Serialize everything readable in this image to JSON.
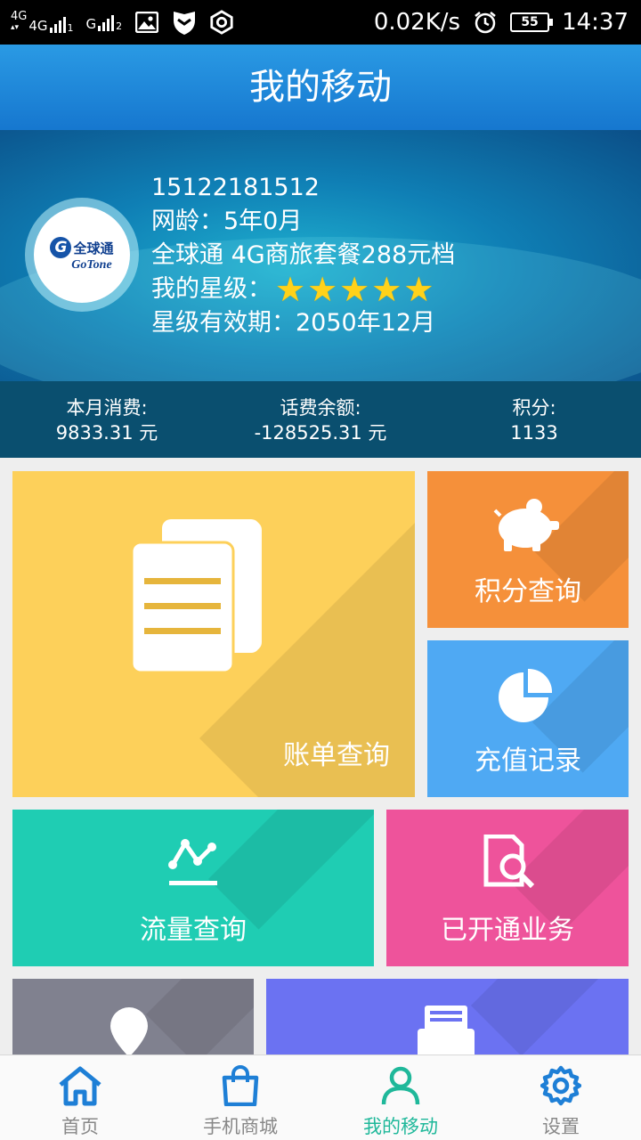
{
  "status_bar": {
    "sim1_label": "4G",
    "sim1_sub": "1",
    "sim2_label": "G",
    "sim2_sub": "2",
    "net_label": "4G",
    "speed": "0.02K/s",
    "battery": "55",
    "time": "14:37",
    "icons": [
      "image-icon",
      "shield-icon",
      "hexagon-settings-icon",
      "alarm-icon"
    ]
  },
  "header": {
    "title": "我的移动"
  },
  "profile": {
    "logo_cn": "全球通",
    "logo_en": "GoTone",
    "phone": "15122181512",
    "net_age": "网龄：5年0月",
    "plan": "全球通 4G商旅套餐288元档",
    "star_label": "我的星级：",
    "star_count": 5,
    "star_validity": "星级有效期：2050年12月"
  },
  "stats": [
    {
      "label": "本月消费:",
      "value": "9833.31 元"
    },
    {
      "label": "话费余额:",
      "value": "-128525.31 元"
    },
    {
      "label": "积分:",
      "value": "1133"
    }
  ],
  "tiles": {
    "bill": "账单查询",
    "points": "积分查询",
    "recharge": "充值记录",
    "flow": "流量查询",
    "services": "已开通业务"
  },
  "colors": {
    "bill": "#fdd05a",
    "points": "#f5903a",
    "recharge": "#4fa9f3",
    "flow": "#1fcdb3",
    "services": "#ee539b",
    "location": "#80818f",
    "print": "#6b72f2",
    "nav_active": "#1fb89a",
    "nav_icon": "#1e7fd6"
  },
  "nav": [
    {
      "label": "首页",
      "icon": "home-icon",
      "active": false
    },
    {
      "label": "手机商城",
      "icon": "shopping-bag-icon",
      "active": false
    },
    {
      "label": "我的移动",
      "icon": "user-icon",
      "active": true
    },
    {
      "label": "设置",
      "icon": "gear-icon",
      "active": false
    }
  ]
}
